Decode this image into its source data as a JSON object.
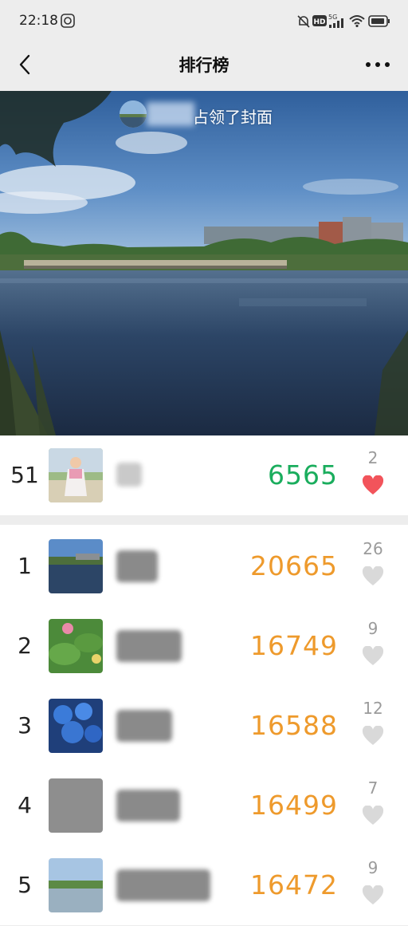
{
  "status_bar": {
    "time": "22:18",
    "network": "5G"
  },
  "header": {
    "title": "排行榜"
  },
  "cover": {
    "owner_text": "占领了封面"
  },
  "colors": {
    "my_steps": "#1aad5d",
    "rank_steps": "#ee9a2c",
    "heart_liked": "#f2545b",
    "heart_default": "#d9d9d9"
  },
  "my_entry": {
    "rank": "51",
    "steps": "6565",
    "likes": "2",
    "liked": true
  },
  "ranking": [
    {
      "rank": "1",
      "steps": "20665",
      "likes": "26"
    },
    {
      "rank": "2",
      "steps": "16749",
      "likes": "9"
    },
    {
      "rank": "3",
      "steps": "16588",
      "likes": "12"
    },
    {
      "rank": "4",
      "steps": "16499",
      "likes": "7"
    },
    {
      "rank": "5",
      "steps": "16472",
      "likes": "9"
    }
  ]
}
